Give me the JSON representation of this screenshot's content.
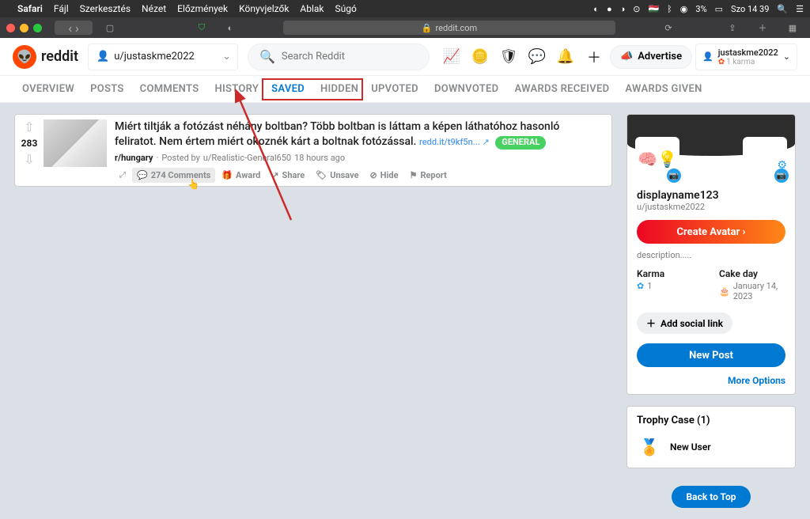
{
  "menubar": {
    "app": "Safari",
    "items": [
      "Fájl",
      "Szerkesztés",
      "Nézet",
      "Előzmények",
      "Könyvjelzők",
      "Ablak",
      "Súgó"
    ],
    "battery": "3%",
    "clock": "Szo 14 39"
  },
  "safari": {
    "url": "reddit.com"
  },
  "header": {
    "brand": "reddit",
    "community": "u/justaskme2022",
    "search_placeholder": "Search Reddit",
    "advertise": "Advertise",
    "username": "justaskme2022",
    "karma": "1 karma"
  },
  "tabs": [
    "OVERVIEW",
    "POSTS",
    "COMMENTS",
    "HISTORY",
    "SAVED",
    "HIDDEN",
    "UPVOTED",
    "DOWNVOTED",
    "AWARDS RECEIVED",
    "AWARDS GIVEN"
  ],
  "post": {
    "score": "283",
    "title": "Miért tiltják a fotózást néhány boltban? Több boltban is láttam a képen láthatóhoz hasonló feliratot. Nem értem miért okoznék kárt a boltnak fotózással.",
    "shortlink": "redd.it/t9kf5n... ↗",
    "flair": "GENERAL",
    "subreddit": "r/hungary",
    "posted_by_prefix": "Posted by",
    "author": "u/Realistic-General650",
    "time": "18 hours ago",
    "comments": "274 Comments",
    "award": "Award",
    "share": "Share",
    "unsave": "Unsave",
    "hide": "Hide",
    "report": "Report"
  },
  "profile": {
    "displayname": "displayname123",
    "handle": "u/justaskme2022",
    "create_avatar": "Create Avatar",
    "description": "description.....",
    "karma_lbl": "Karma",
    "karma_val": "1",
    "cake_lbl": "Cake day",
    "cake_val": "January 14, 2023",
    "add_social": "Add social link",
    "new_post": "New Post",
    "more": "More Options"
  },
  "trophy": {
    "title": "Trophy Case (1)",
    "item": "New User"
  },
  "back_to_top": "Back to Top"
}
